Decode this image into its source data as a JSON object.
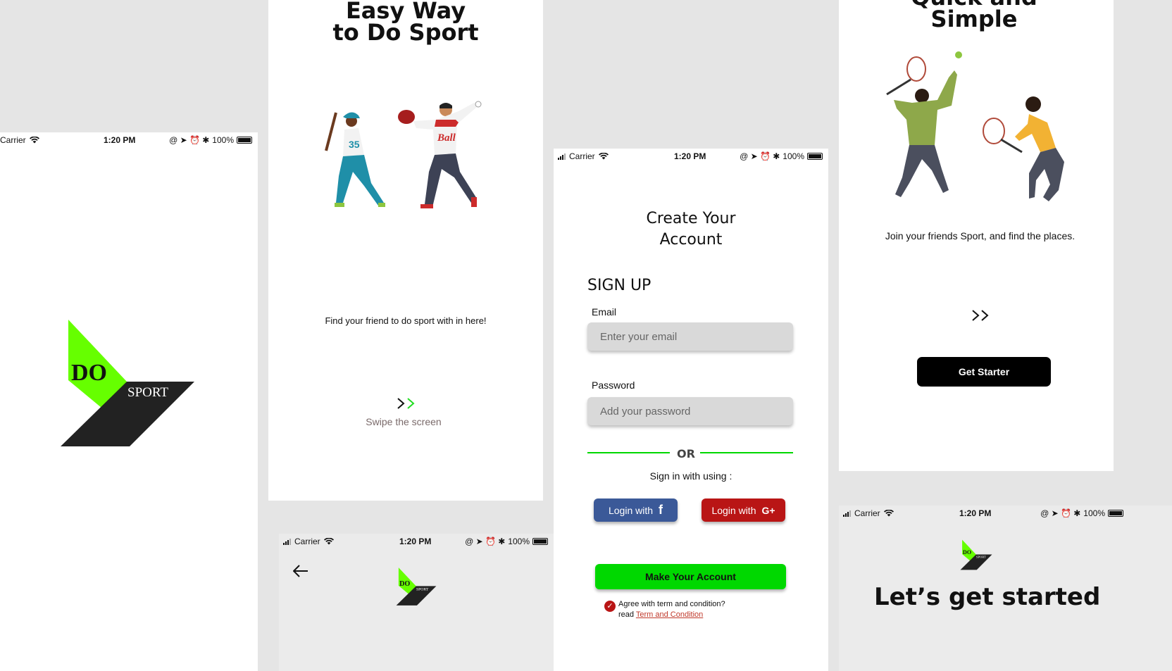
{
  "status_bar": {
    "carrier": "Carrier",
    "time": "1:20 PM",
    "battery": "100%"
  },
  "splash": {
    "logo_do": "DO",
    "logo_sport": "SPORT"
  },
  "onboard1": {
    "title_line1": "Easy Way",
    "title_line2": "to Do Sport",
    "subtitle": "Find your friend to do sport with in here!",
    "swipe_text": "Swipe the screen"
  },
  "logo_header": {
    "logo_do": "DO",
    "logo_sport": "SPORT"
  },
  "signup": {
    "heading_line1": "Create Your",
    "heading_line2": "Account",
    "section_title": "SIGN UP",
    "email_label": "Email",
    "email_placeholder": "Enter your email",
    "password_label": "Password",
    "password_placeholder": "Add your password",
    "or_text": "OR",
    "sign_in_with": "Sign in with using :",
    "facebook_button": "Login with",
    "google_button": "Login with",
    "make_account_button": "Make Your Account",
    "agree_text": "Agree with term and condition?",
    "read_text": "read",
    "terms_link": "Term and Condition"
  },
  "onboard2": {
    "title_line1": "Quick and",
    "title_line2": "Simple",
    "subtitle": "Join your friends Sport, and find the places.",
    "get_started_button": "Get Starter"
  },
  "get_started": {
    "title": "Let’s get started",
    "logo_do": "DO",
    "logo_sport": "SPORT"
  },
  "colors": {
    "accent_green": "#00d800",
    "logo_green": "#66ff00",
    "facebook": "#3b5998",
    "google": "#b91515",
    "dark": "#222222"
  }
}
